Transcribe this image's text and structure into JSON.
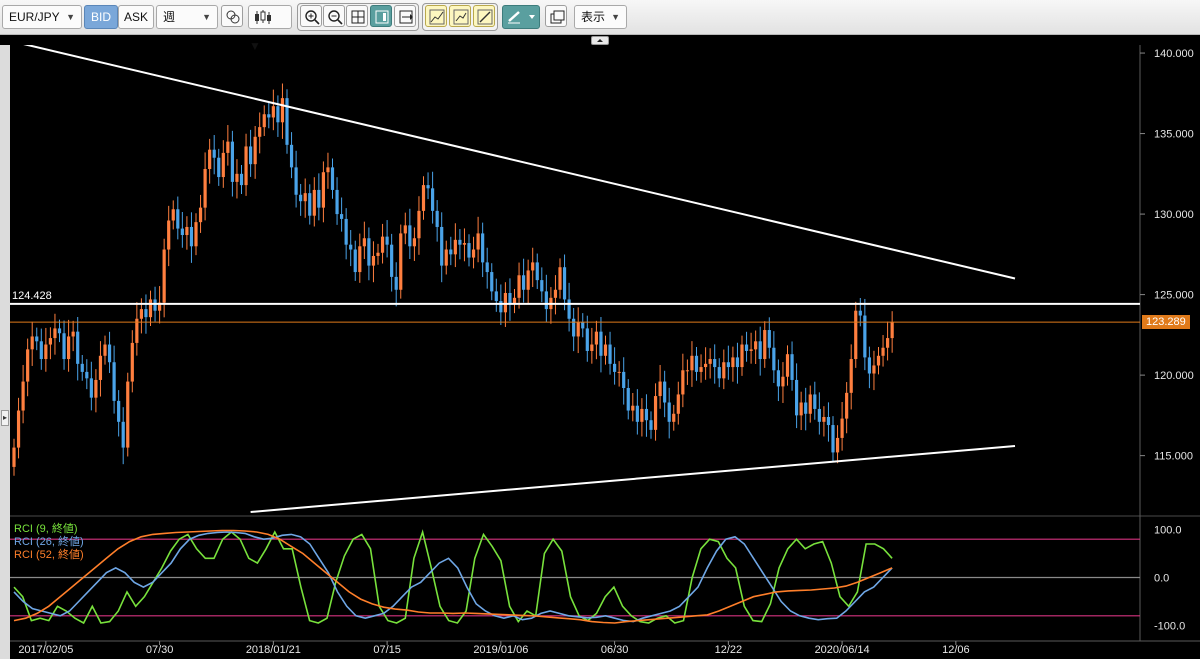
{
  "toolbar": {
    "symbol": "EUR/JPY",
    "bid_label": "BID",
    "ask_label": "ASK",
    "timeframe": "週",
    "display_label": "表示"
  },
  "chart_data": {
    "type": "candlestick",
    "symbol": "EUR/JPY",
    "timeframe": "週",
    "ylim": [
      111.5,
      140.5
    ],
    "y_ticks": [
      "140.000",
      "135.000",
      "130.000",
      "125.000",
      "120.000",
      "115.000"
    ],
    "y_tick_values": [
      140,
      135,
      130,
      125,
      120,
      115
    ],
    "x_labels": [
      "2017/02/05",
      "07/30",
      "2018/01/21",
      "07/15",
      "2019/01/06",
      "06/30",
      "12/22",
      "2020/06/14",
      "12/06"
    ],
    "x_label_index": [
      7,
      32,
      57,
      82,
      107,
      132,
      157,
      182,
      207
    ],
    "bullish_color": "#ff7f3f",
    "bearish_color": "#4aa3e8",
    "closes": [
      115.5,
      117.8,
      119.6,
      121.6,
      122.4,
      122.1,
      121.0,
      121.9,
      122.3,
      122.9,
      122.6,
      121.0,
      122.4,
      122.7,
      120.7,
      120.2,
      119.8,
      118.6,
      119.7,
      121.2,
      121.9,
      120.8,
      118.4,
      117.1,
      115.5,
      119.6,
      122.0,
      123.5,
      124.1,
      123.6,
      124.7,
      124.0,
      124.5,
      127.8,
      129.6,
      130.3,
      129.1,
      128.7,
      129.2,
      128.0,
      129.5,
      130.4,
      132.8,
      134.0,
      133.5,
      132.3,
      133.8,
      134.5,
      132.0,
      132.5,
      131.8,
      134.2,
      133.1,
      134.8,
      135.4,
      136.2,
      136.0,
      136.7,
      135.7,
      137.2,
      134.3,
      132.9,
      131.2,
      130.8,
      131.3,
      129.9,
      131.5,
      130.4,
      132.6,
      132.9,
      131.5,
      130.0,
      129.7,
      128.1,
      127.8,
      126.4,
      128.0,
      128.5,
      126.8,
      127.4,
      127.6,
      128.6,
      128.1,
      126.1,
      125.3,
      128.8,
      129.3,
      128.0,
      128.5,
      130.2,
      131.8,
      131.6,
      130.2,
      129.2,
      126.8,
      127.8,
      127.5,
      128.4,
      128.1,
      128.2,
      127.3,
      127.8,
      128.8,
      127.0,
      126.4,
      125.2,
      124.6,
      123.9,
      125.1,
      124.4,
      124.8,
      126.2,
      125.3,
      126.5,
      127.0,
      125.9,
      125.2,
      124.1,
      124.8,
      125.3,
      126.7,
      124.7,
      123.5,
      122.4,
      123.3,
      122.9,
      121.5,
      121.9,
      122.7,
      121.2,
      121.9,
      120.7,
      120.2,
      120.2,
      119.2,
      117.8,
      118.1,
      117.1,
      117.9,
      117.2,
      116.6,
      118.7,
      119.6,
      118.3,
      117.1,
      117.6,
      118.8,
      120.3,
      120.3,
      121.2,
      120.2,
      120.5,
      120.7,
      121.0,
      120.5,
      119.8,
      120.8,
      120.5,
      121.1,
      120.5,
      121.9,
      121.5,
      121.6,
      122.1,
      121.0,
      122.8,
      121.7,
      120.3,
      119.3,
      119.9,
      121.3,
      119.7,
      117.5,
      118.3,
      117.6,
      118.8,
      117.9,
      117.1,
      117.4,
      116.9,
      115.2,
      116.1,
      117.3,
      118.9,
      121.0,
      124.0,
      123.7,
      121.1,
      120.1,
      120.6,
      121.2,
      121.7,
      122.3,
      123.3
    ],
    "price_lines": [
      {
        "label": "124.428",
        "value": 124.428,
        "color": "#ffffff"
      },
      {
        "label": "123.289",
        "value": 123.289,
        "color": "#e07a1a"
      }
    ],
    "trendlines": [
      {
        "from": [
          0,
          140.7
        ],
        "to": [
          220,
          126.0
        ],
        "color": "#ffffff"
      },
      {
        "from": [
          52,
          111.5
        ],
        "to": [
          220,
          115.6
        ],
        "color": "#ffffff"
      }
    ],
    "indicator": {
      "type": "line",
      "ylim": [
        -120,
        120
      ],
      "y_ticks": [
        "100.0",
        "0.0",
        "-100.0"
      ],
      "y_tick_values": [
        100,
        0,
        -100
      ],
      "levels": [
        80,
        0,
        -80
      ],
      "series": [
        {
          "name": "RCI (9, 終値)",
          "color": "#78e13c",
          "values": [
            -20,
            -40,
            -90,
            -85,
            -90,
            -60,
            -70,
            -85,
            -95,
            -60,
            -95,
            -92,
            -70,
            -30,
            -60,
            -40,
            -10,
            20,
            55,
            80,
            90,
            60,
            40,
            40,
            80,
            95,
            80,
            40,
            30,
            60,
            95,
            60,
            60,
            -20,
            -90,
            -95,
            -85,
            -10,
            45,
            80,
            90,
            60,
            -60,
            -90,
            -95,
            -85,
            40,
            95,
            20,
            -60,
            -90,
            -95,
            -70,
            40,
            90,
            65,
            35,
            -60,
            -92,
            -70,
            -80,
            50,
            80,
            55,
            -40,
            -80,
            -90,
            -75,
            -40,
            -20,
            -60,
            -80,
            -92,
            -95,
            -85,
            -80,
            -95,
            -90,
            0,
            60,
            80,
            75,
            40,
            20,
            -60,
            -90,
            -92,
            -55,
            20,
            60,
            80,
            60,
            70,
            75,
            30,
            -40,
            -60,
            -30,
            70,
            70,
            60,
            40
          ]
        },
        {
          "name": "RCI (26, 終値)",
          "color": "#6fa7e6",
          "values": [
            -30,
            -50,
            -65,
            -70,
            -75,
            -80,
            -70,
            -50,
            -30,
            -10,
            10,
            20,
            10,
            -10,
            -20,
            -10,
            10,
            30,
            60,
            80,
            88,
            92,
            94,
            95,
            94,
            92,
            85,
            80,
            82,
            88,
            90,
            85,
            70,
            40,
            10,
            -30,
            -60,
            -80,
            -85,
            -80,
            -75,
            -60,
            -40,
            -20,
            -10,
            10,
            30,
            40,
            20,
            -20,
            -55,
            -70,
            -80,
            -85,
            -80,
            -88,
            -85,
            -75,
            -70,
            -75,
            -80,
            -82,
            -84,
            -83,
            -80,
            -85,
            -90,
            -92,
            -85,
            -80,
            -75,
            -70,
            -60,
            -40,
            -20,
            20,
            55,
            80,
            85,
            70,
            40,
            10,
            -20,
            -50,
            -70,
            -80,
            -85,
            -88,
            -86,
            -85,
            -70,
            -50,
            -30,
            -20,
            0,
            20
          ]
        },
        {
          "name": "RCI (52, 終値)",
          "color": "#ff7f2a",
          "values": [
            -90,
            -85,
            -75,
            -60,
            -40,
            -20,
            0,
            20,
            40,
            60,
            75,
            85,
            90,
            92,
            94,
            95,
            96,
            97,
            98,
            98,
            97,
            95,
            90,
            80,
            65,
            50,
            30,
            10,
            -10,
            -30,
            -45,
            -55,
            -62,
            -66,
            -68,
            -72,
            -74,
            -74,
            -75,
            -74,
            -75,
            -76,
            -77,
            -78,
            -79,
            -80,
            -82,
            -84,
            -86,
            -88,
            -92,
            -94,
            -95,
            -92,
            -90,
            -88,
            -86,
            -84,
            -82,
            -80,
            -78,
            -70,
            -60,
            -50,
            -40,
            -35,
            -30,
            -28,
            -27,
            -26,
            -24,
            -22,
            -18,
            -10,
            0,
            10,
            20
          ]
        }
      ]
    }
  }
}
